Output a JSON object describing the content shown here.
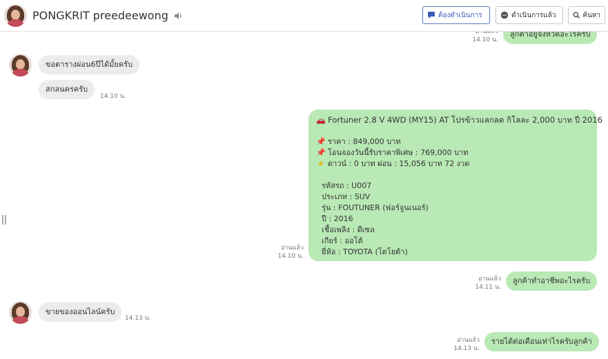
{
  "header": {
    "title": "PONGKRIT preedeewong",
    "buttons": {
      "todo": "ต้องดำเนินการ",
      "done": "ดำเนินการแล้ว",
      "search": "ค้นหา"
    },
    "accent_color": "#3b5bb8"
  },
  "messages": {
    "partial_top": {
      "text": "ลูกค้าอยู่จังหวัดอะไรครับ",
      "read": "อ่านแล้ว",
      "time": "14.10 น."
    },
    "in1": {
      "text": "ขอตารางผ่อน6ปีได้มั้ยครับ"
    },
    "in2": {
      "text": "สกลนครครับ",
      "time": "14.10 น."
    },
    "card": {
      "title": "Fortuner 2.8 V 4WD (MY15) AT โปรข้าวแลกลด กิโลละ 2,000 บาท ปี 2016",
      "price": "ราคา : 849,000 บาท",
      "special": "โอนจองวันนี้รับราคาพิเศษ : 769,000 บาท",
      "down": "ดาวน์ : 0 บาท ผ่อน : 15,056 บาท 72 งวด",
      "details": [
        "รหัสรถ : U007",
        "ประเภท : SUV",
        "รุ่น : FOUTUNER (ฟอร์จูนเนอร์)",
        "ปี : 2016",
        "เชื้อเพลิง : ดีเซล",
        "เกียร์ : ออโต้",
        "ยี่ห้อ : TOYOTA (โตโยต้า)"
      ],
      "read": "อ่านแล้ว",
      "time": "14.10 น."
    },
    "out2": {
      "text": "ลูกค้าทำอาชีพอะไรครับ",
      "read": "อ่านแล้ว",
      "time": "14.11 น."
    },
    "in3": {
      "text": "ขายของออนไลน์ครับ",
      "time": "14.13 น."
    },
    "out3": {
      "text": "รายได้ต่อเดือนเท่าไรครับลูกค้า",
      "read": "อ่านแล้ว",
      "time": "14.13 น."
    }
  },
  "colors": {
    "outgoing_bubble": "#b9e9b5",
    "incoming_bubble": "#ececec"
  },
  "icons": {
    "title_icon": "speaker-icon",
    "todo_icon": "chat-bubble-icon",
    "done_icon": "chat-dots-icon",
    "search_icon": "search-icon",
    "car_icon": "car-emoji",
    "pin_icon": "pushpin-emoji",
    "star_icon": "star-emoji"
  }
}
